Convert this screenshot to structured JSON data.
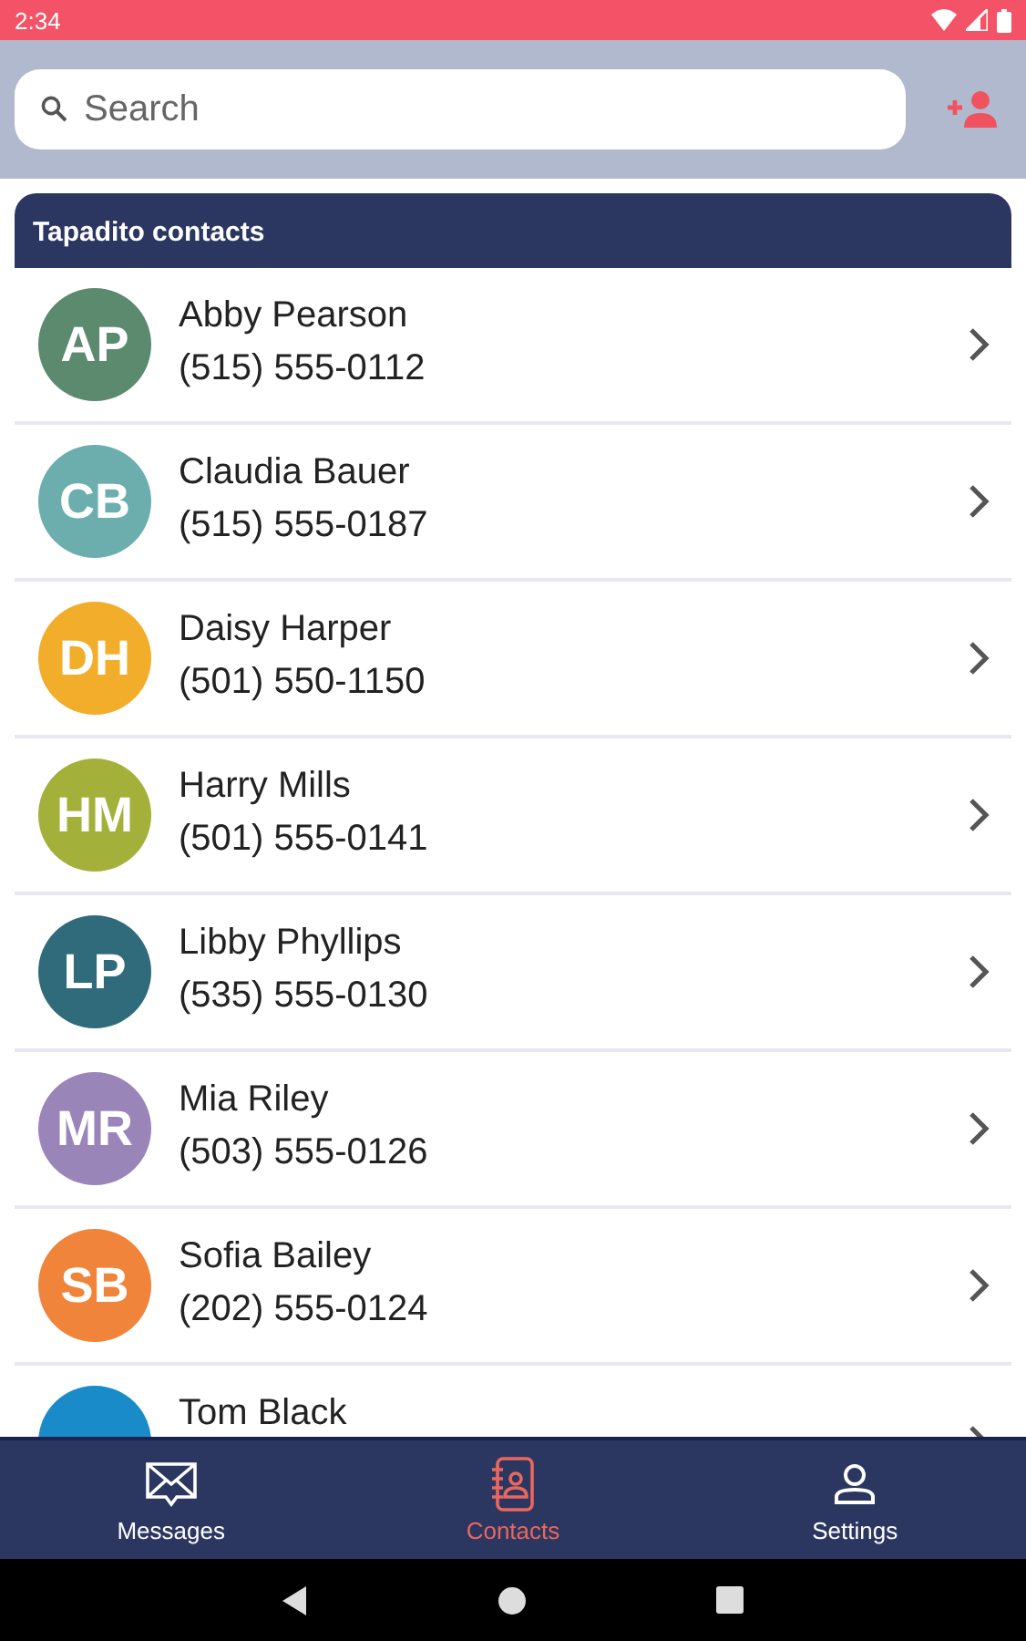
{
  "status_bar": {
    "time": "2:34"
  },
  "search": {
    "placeholder": "Search"
  },
  "list": {
    "title": "Tapadito contacts",
    "contacts": [
      {
        "initials": "AP",
        "name": "Abby Pearson",
        "phone": "(515) 555-0112",
        "color": "#5b8a6f"
      },
      {
        "initials": "CB",
        "name": "Claudia Bauer",
        "phone": "(515) 555-0187",
        "color": "#6cadae"
      },
      {
        "initials": "DH",
        "name": "Daisy Harper",
        "phone": "(501) 550-1150",
        "color": "#f2ad2a"
      },
      {
        "initials": "HM",
        "name": "Harry Mills",
        "phone": "(501) 555-0141",
        "color": "#a3b13b"
      },
      {
        "initials": "LP",
        "name": "Libby Phyllips",
        "phone": "(535) 555-0130",
        "color": "#2f6b7b"
      },
      {
        "initials": "MR",
        "name": "Mia Riley",
        "phone": "(503) 555-0126",
        "color": "#9a85b9"
      },
      {
        "initials": "SB",
        "name": "Sofia Bailey",
        "phone": "(202) 555-0124",
        "color": "#f0843b"
      },
      {
        "name": "Tom Black",
        "color": "#1a8bc9"
      }
    ]
  },
  "tabs": [
    {
      "label": "Messages",
      "kind": "messages",
      "selected": false
    },
    {
      "label": "Contacts",
      "kind": "contacts",
      "selected": true
    },
    {
      "label": "Settings",
      "kind": "settings",
      "selected": false
    }
  ]
}
